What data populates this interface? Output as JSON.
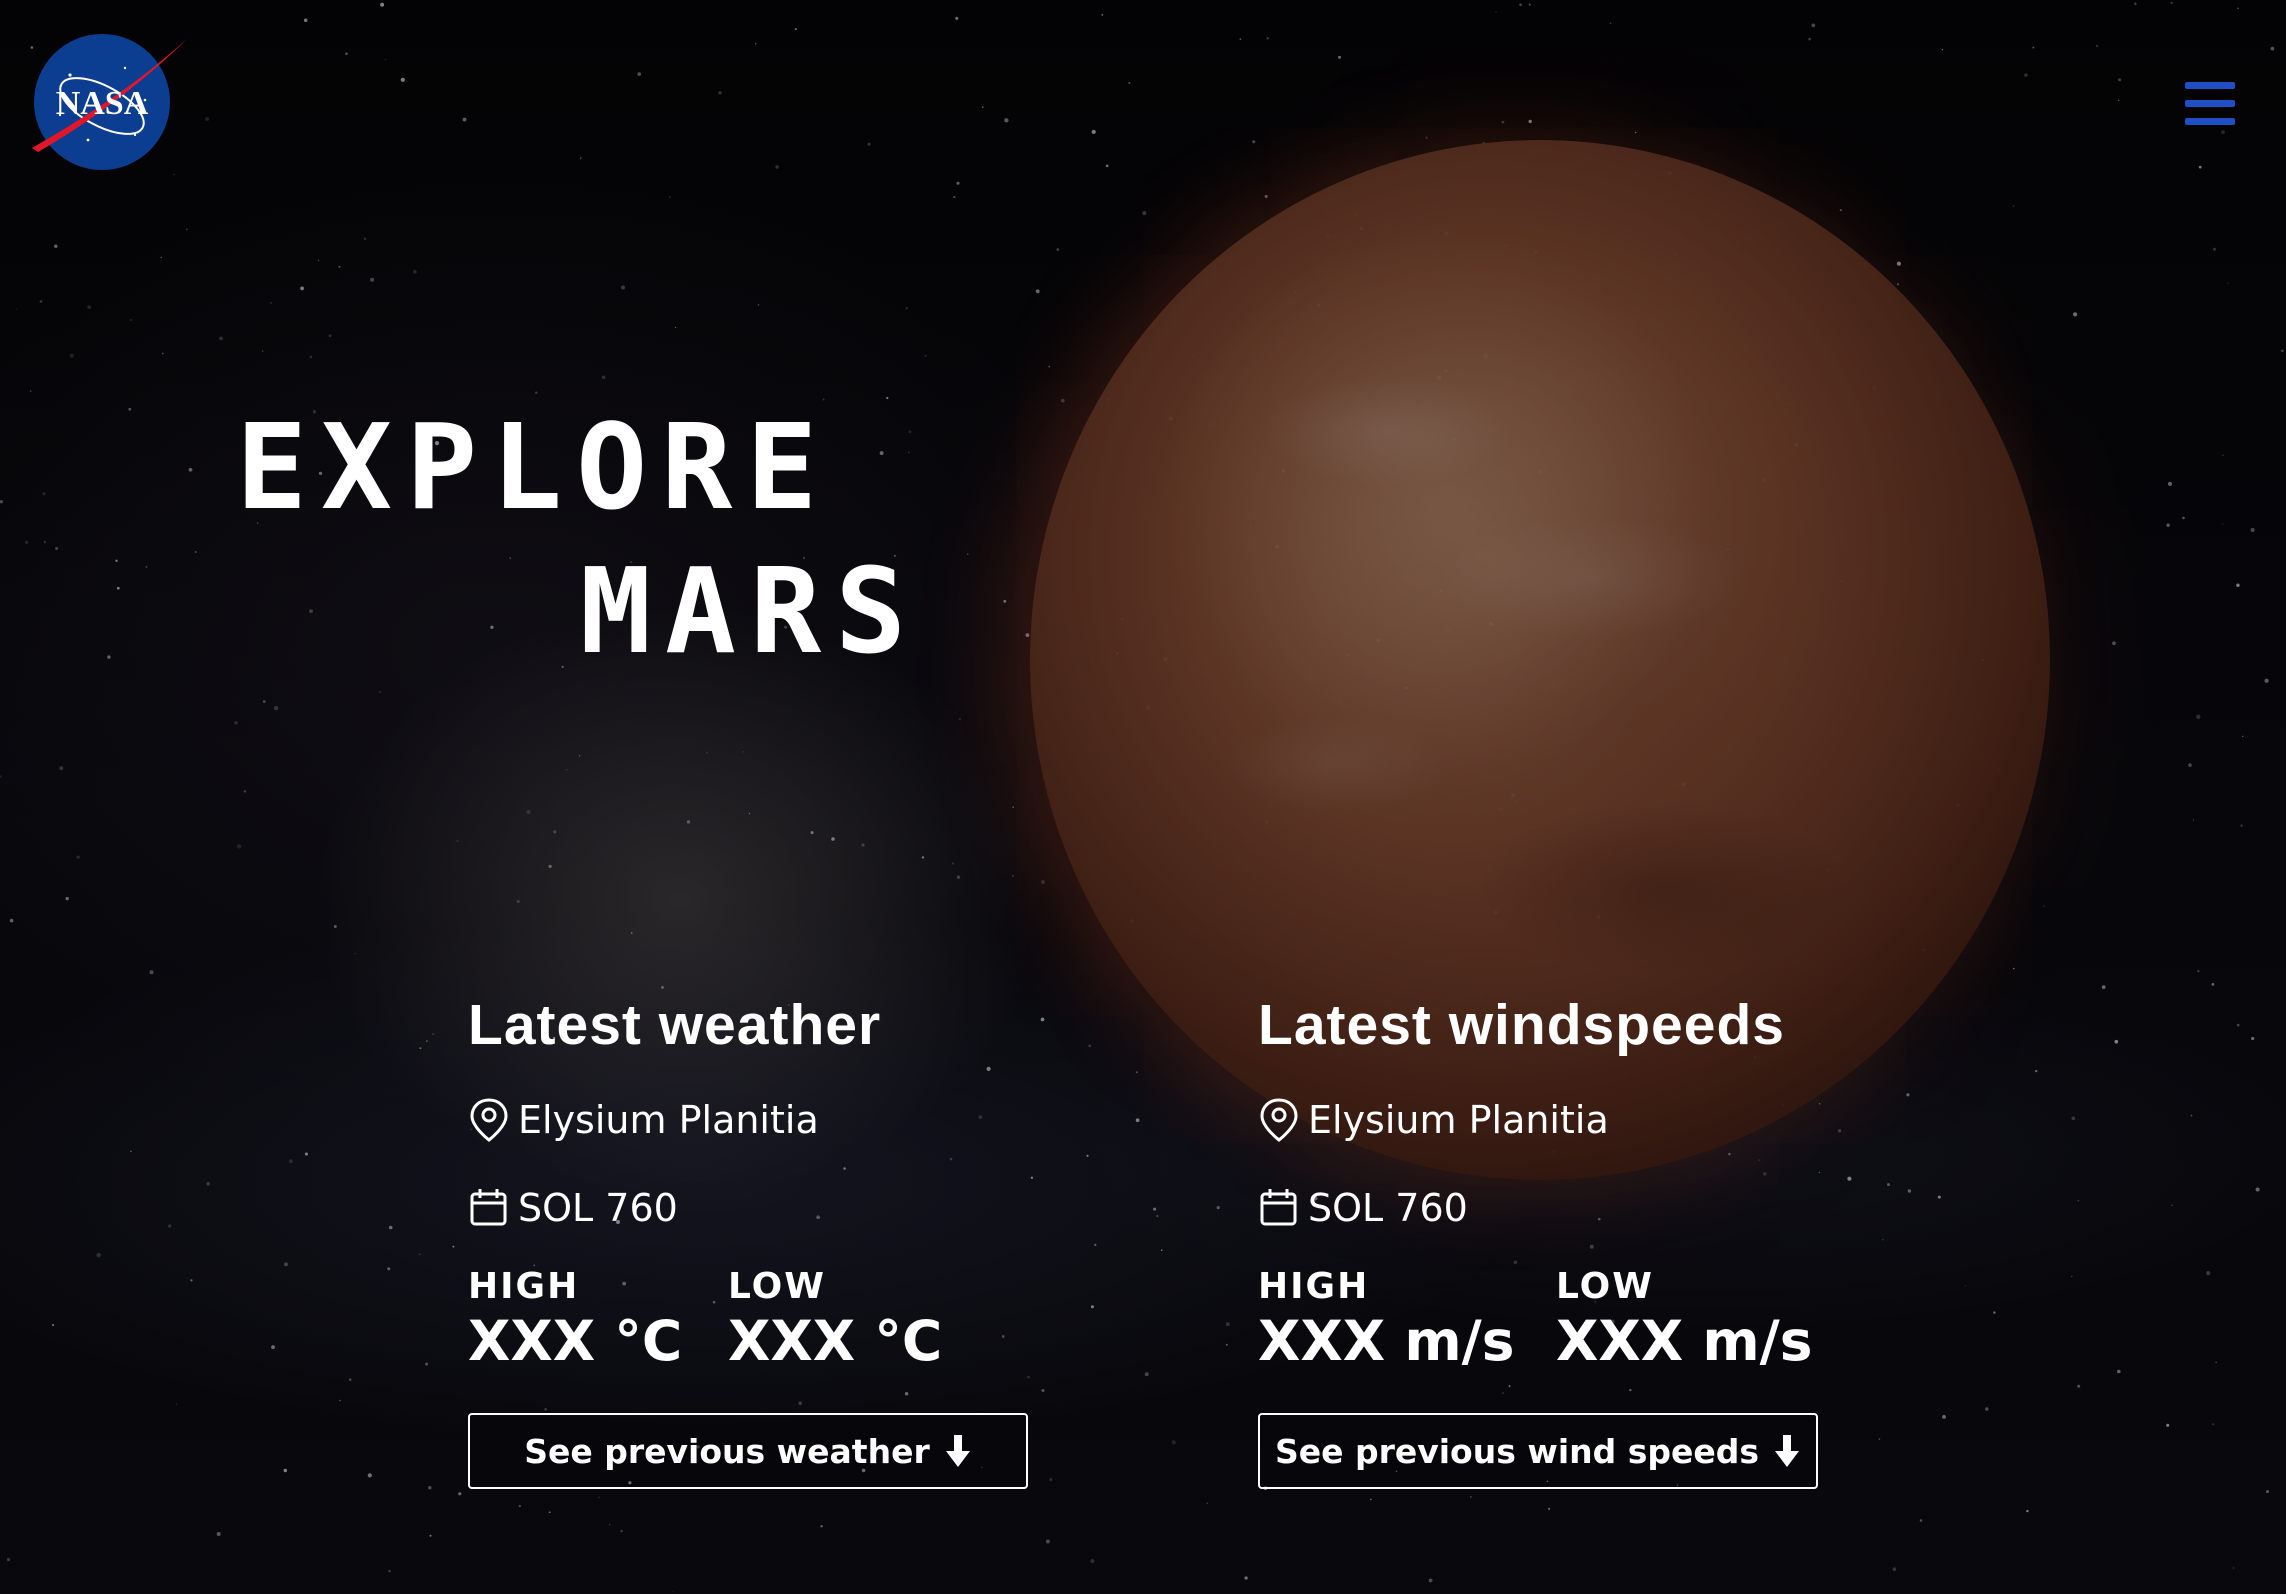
{
  "brand": {
    "logo_text": "NASA",
    "colors": {
      "accent": "#1f4fc4",
      "logo_blue": "#0b3d91",
      "logo_red": "#e0162b",
      "text": "#ffffff"
    }
  },
  "header": {
    "menu_icon": "hamburger-menu-icon"
  },
  "hero": {
    "line1": "EXPLORE",
    "line2": "MARS"
  },
  "weather": {
    "title": "Latest weather",
    "location": "Elysium Planitia",
    "sol": "SOL 760",
    "high_label": "HIGH",
    "high_value": "XXX °C",
    "low_label": "LOW",
    "low_value": "XXX °C",
    "button_label": "See previous weather"
  },
  "wind": {
    "title": "Latest windspeeds",
    "location": "Elysium Planitia",
    "sol": "SOL 760",
    "high_label": "HIGH",
    "high_value": "XXX m/s",
    "low_label": "LOW",
    "low_value": "XXX m/s",
    "button_label": "See previous wind speeds"
  },
  "icons": {
    "location": "map-pin-icon",
    "date": "calendar-icon",
    "arrow": "arrow-down-icon"
  }
}
